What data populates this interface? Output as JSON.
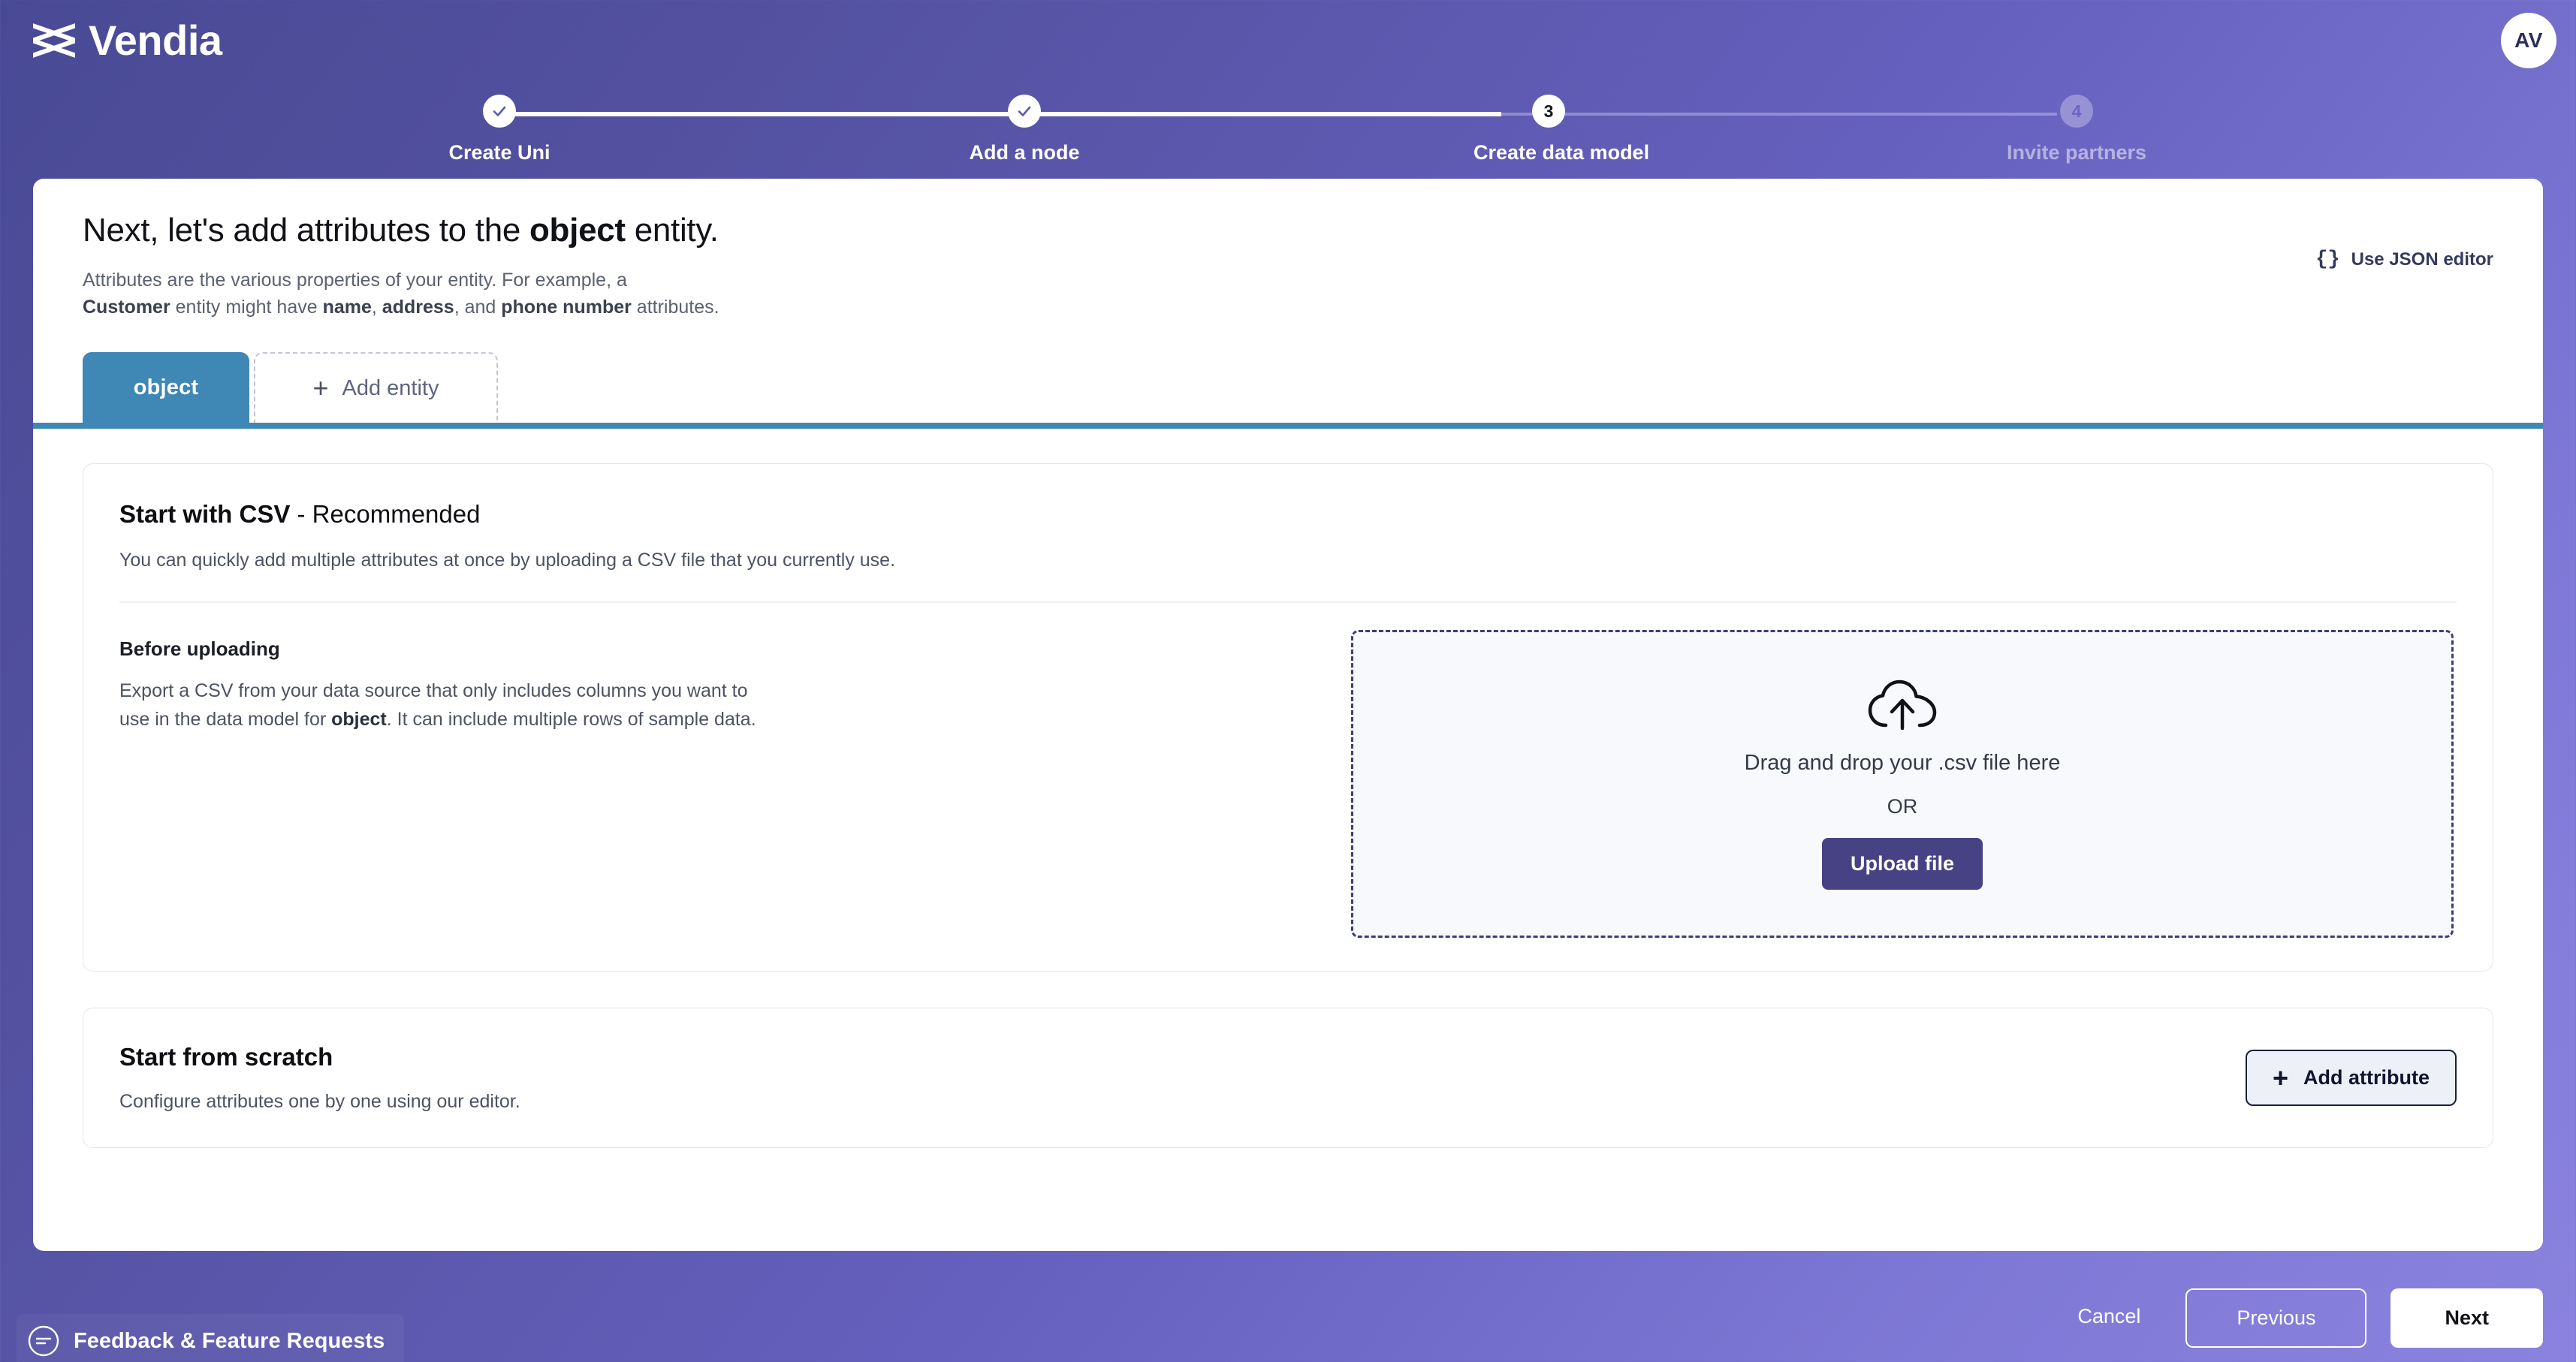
{
  "brand": {
    "name": "Vendia",
    "logo_icon": "vendia-logo-icon",
    "accent_purple": "#5d58b8",
    "accent_teal": "#3f87b4",
    "accent_indigo": "#474284"
  },
  "account": {
    "avatar_initials": "AV"
  },
  "stepper": {
    "steps": [
      {
        "number": "1",
        "label": "Create Uni",
        "state": "done",
        "marker": "check-icon"
      },
      {
        "number": "2",
        "label": "Add a node",
        "state": "done",
        "marker": "check-icon"
      },
      {
        "number": "3",
        "label": "Create data model",
        "state": "active",
        "marker": "3"
      },
      {
        "number": "4",
        "label": "Invite partners",
        "state": "todo",
        "marker": "4"
      }
    ]
  },
  "header": {
    "title_prefix": "Next, let's add attributes to the ",
    "title_entity": "object",
    "title_suffix": " entity.",
    "subtitle_line1": "Attributes are the various properties of your entity. For example, a",
    "subtitle_l2_a": "Customer",
    "subtitle_l2_b": " entity might have ",
    "subtitle_l2_c": "name",
    "subtitle_l2_d": ", ",
    "subtitle_l2_e": "address",
    "subtitle_l2_f": ", and ",
    "subtitle_l2_g": "phone number",
    "subtitle_l2_h": " attributes.",
    "json_editor_icon": "curly-braces-icon",
    "json_editor_label": "Use JSON editor"
  },
  "tabs": {
    "active_label": "object",
    "add_plus": "+",
    "add_label": "Add entity"
  },
  "csv_card": {
    "title_bold": "Start with CSV",
    "title_light": " - Recommended",
    "description": "You can quickly add multiple attributes at once by uploading a CSV file that you currently use.",
    "before_title": "Before uploading",
    "before_line1": "Export a CSV from your data source that only includes columns you want to",
    "before_l2_a": "use in the data model for ",
    "before_l2_entity": "object",
    "before_l2_b": ". It can include multiple rows of sample data.",
    "dropzone": {
      "icon": "cloud-upload-icon",
      "drag_text": "Drag and drop your .csv file here",
      "or_text": "OR",
      "upload_button": "Upload file"
    }
  },
  "scratch_card": {
    "title": "Start from scratch",
    "description": "Configure attributes one by one using our editor.",
    "add_attribute_plus": "+",
    "add_attribute_label": "Add attribute"
  },
  "footer": {
    "cancel_label": "Cancel",
    "previous_label": "Previous",
    "next_label": "Next"
  },
  "feedback": {
    "icon": "feedback-circle-icon",
    "label": "Feedback & Feature Requests"
  }
}
